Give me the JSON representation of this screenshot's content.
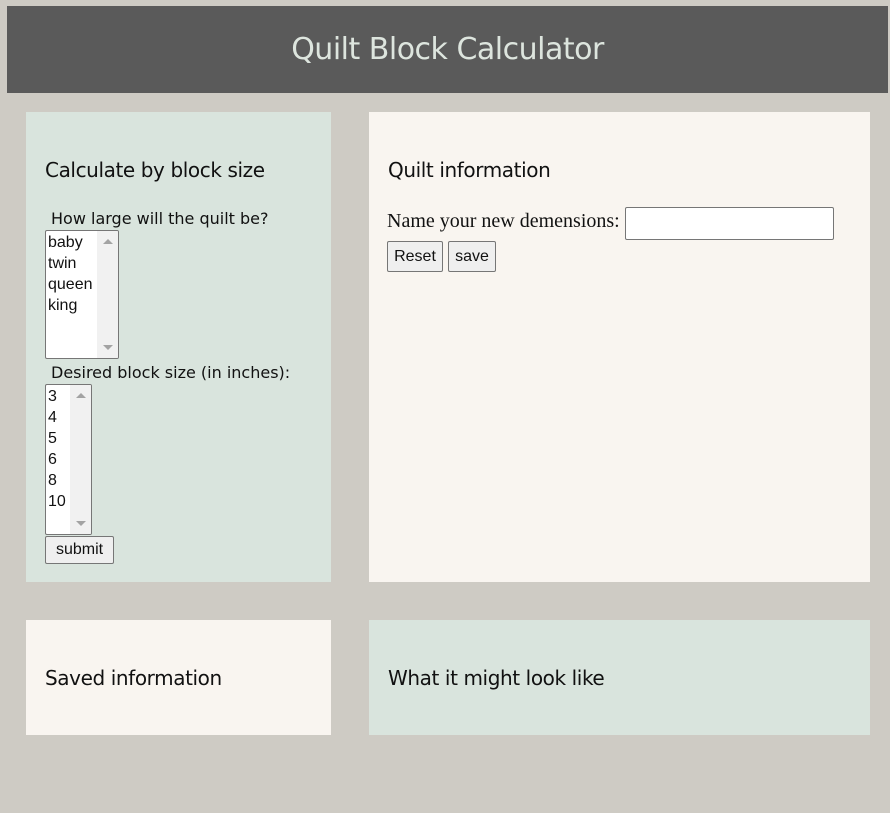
{
  "header": {
    "title": "Quilt Block Calculator"
  },
  "calc": {
    "heading": "Calculate by block size",
    "size_label": "How large will the quilt be?",
    "size_options": [
      "baby",
      "twin",
      "queen",
      "king"
    ],
    "block_label": "Desired block size (in inches):",
    "block_options": [
      "3",
      "4",
      "5",
      "6",
      "8",
      "10"
    ],
    "submit_label": "submit"
  },
  "info": {
    "heading": "Quilt information",
    "name_label": "Name your new demensions:",
    "name_value": "",
    "reset_label": "Reset",
    "save_label": "save"
  },
  "saved": {
    "heading": "Saved information"
  },
  "preview": {
    "heading": "What it might look like"
  },
  "colors": {
    "background": "#cecbc4",
    "header": "#5a5a5a",
    "panel_green": "#d9e4dd",
    "panel_cream": "#f9f5f0"
  }
}
